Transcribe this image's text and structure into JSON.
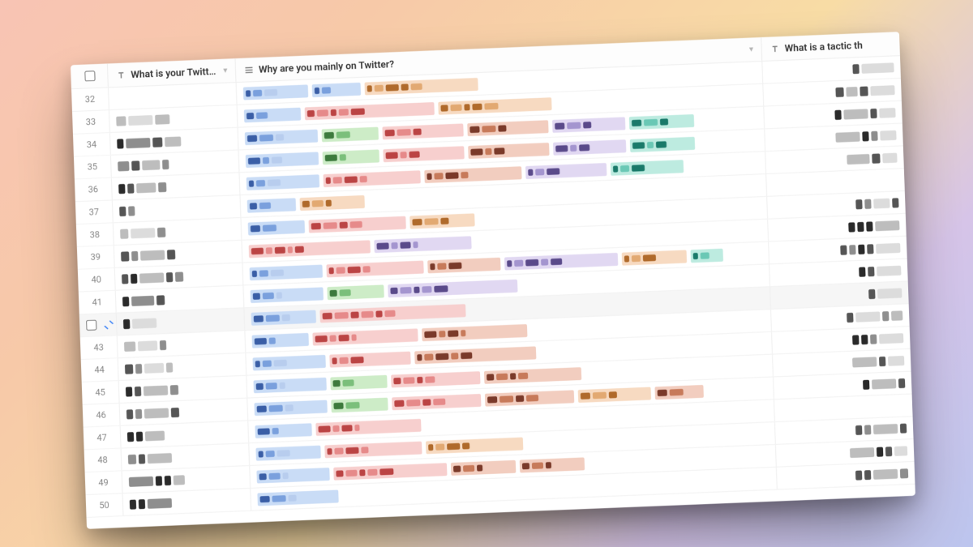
{
  "header": {
    "col1": "What is your Twitte…",
    "col2": "Why are you mainly on Twitter?",
    "col3": "What is a tactic th"
  },
  "chips": {
    "blue": "#c9dcf6",
    "green": "#cdecc7",
    "pink": "#f7cfce",
    "orange": "#f7dac1",
    "violet": "#e1d8f2",
    "rust": "#f2cdbf",
    "teal": "#bdebe0",
    "tan": "#f3e6c9"
  },
  "rows": [
    {
      "n": "32",
      "sel": false,
      "c1": [],
      "tags": [
        [
          "blue",
          80
        ],
        [
          "blue",
          60
        ],
        [
          "orange",
          140
        ]
      ],
      "c3": [
        [
          8,
          "g4"
        ],
        [
          40,
          "g1"
        ]
      ]
    },
    {
      "n": "33",
      "sel": false,
      "c1": [
        [
          12,
          "g2"
        ],
        [
          30,
          "g1"
        ],
        [
          18,
          "g2"
        ]
      ],
      "tags": [
        [
          "blue",
          70
        ],
        [
          "pink",
          160
        ],
        [
          "orange",
          140
        ]
      ],
      "c3": [
        [
          10,
          "g4"
        ],
        [
          14,
          "g2"
        ],
        [
          10,
          "g4"
        ],
        [
          30,
          "g1"
        ]
      ]
    },
    {
      "n": "34",
      "sel": false,
      "c1": [
        [
          8,
          "g5"
        ],
        [
          30,
          "g3"
        ],
        [
          12,
          "g4"
        ],
        [
          20,
          "g2"
        ]
      ],
      "tags": [
        [
          "blue",
          90
        ],
        [
          "green",
          70
        ],
        [
          "pink",
          100
        ],
        [
          "rust",
          100
        ],
        [
          "violet",
          90
        ],
        [
          "teal",
          80
        ]
      ],
      "c3": [
        [
          8,
          "g5"
        ],
        [
          30,
          "g2"
        ],
        [
          8,
          "g4"
        ],
        [
          20,
          "g1"
        ]
      ]
    },
    {
      "n": "35",
      "sel": false,
      "c1": [
        [
          14,
          "g3"
        ],
        [
          10,
          "g4"
        ],
        [
          22,
          "g2"
        ],
        [
          8,
          "g3"
        ]
      ],
      "tags": [
        [
          "blue",
          90
        ],
        [
          "green",
          70
        ],
        [
          "pink",
          100
        ],
        [
          "rust",
          100
        ],
        [
          "violet",
          90
        ],
        [
          "teal",
          80
        ]
      ],
      "c3": [
        [
          30,
          "g2"
        ],
        [
          8,
          "g5"
        ],
        [
          8,
          "g3"
        ],
        [
          20,
          "g1"
        ]
      ]
    },
    {
      "n": "36",
      "sel": false,
      "c1": [
        [
          8,
          "g5"
        ],
        [
          8,
          "g4"
        ],
        [
          24,
          "g2"
        ],
        [
          10,
          "g3"
        ]
      ],
      "tags": [
        [
          "blue",
          90
        ],
        [
          "pink",
          120
        ],
        [
          "rust",
          120
        ],
        [
          "violet",
          100
        ],
        [
          "teal",
          90
        ]
      ],
      "c3": [
        [
          28,
          "g2"
        ],
        [
          10,
          "g4"
        ],
        [
          18,
          "g1"
        ]
      ]
    },
    {
      "n": "37",
      "sel": false,
      "c1": [
        [
          8,
          "g4"
        ],
        [
          8,
          "g3"
        ]
      ],
      "tags": [
        [
          "blue",
          60
        ],
        [
          "orange",
          80
        ]
      ],
      "c3": []
    },
    {
      "n": "38",
      "sel": false,
      "c1": [
        [
          10,
          "g2"
        ],
        [
          30,
          "g1"
        ],
        [
          10,
          "g3"
        ]
      ],
      "tags": [
        [
          "blue",
          70
        ],
        [
          "pink",
          120
        ],
        [
          "orange",
          80
        ]
      ],
      "c3": [
        [
          8,
          "g4"
        ],
        [
          8,
          "g3"
        ],
        [
          20,
          "g1"
        ],
        [
          8,
          "g4"
        ]
      ]
    },
    {
      "n": "39",
      "sel": false,
      "c1": [
        [
          10,
          "g4"
        ],
        [
          8,
          "g3"
        ],
        [
          30,
          "g2"
        ],
        [
          10,
          "g4"
        ]
      ],
      "tags": [
        [
          "pink",
          150
        ],
        [
          "violet",
          120
        ]
      ],
      "c3": [
        [
          8,
          "g5"
        ],
        [
          8,
          "g5"
        ],
        [
          8,
          "g5"
        ],
        [
          30,
          "g2"
        ]
      ]
    },
    {
      "n": "40",
      "sel": false,
      "c1": [
        [
          8,
          "g4"
        ],
        [
          8,
          "g5"
        ],
        [
          30,
          "g2"
        ],
        [
          8,
          "g4"
        ],
        [
          10,
          "g3"
        ]
      ],
      "tags": [
        [
          "blue",
          90
        ],
        [
          "pink",
          120
        ],
        [
          "rust",
          90
        ],
        [
          "violet",
          140
        ],
        [
          "orange",
          80
        ],
        [
          "teal",
          40
        ]
      ],
      "c3": [
        [
          8,
          "g4"
        ],
        [
          8,
          "g3"
        ],
        [
          8,
          "g5"
        ],
        [
          8,
          "g4"
        ],
        [
          30,
          "g1"
        ]
      ]
    },
    {
      "n": "41",
      "sel": false,
      "c1": [
        [
          8,
          "g5"
        ],
        [
          28,
          "g3"
        ],
        [
          10,
          "g4"
        ]
      ],
      "tags": [
        [
          "blue",
          90
        ],
        [
          "green",
          70
        ],
        [
          "violet",
          160
        ]
      ],
      "c3": [
        [
          8,
          "g5"
        ],
        [
          8,
          "g4"
        ],
        [
          30,
          "g1"
        ]
      ]
    },
    {
      "n": "",
      "sel": true,
      "c1": [
        [
          8,
          "g5"
        ],
        [
          30,
          "g1"
        ]
      ],
      "tags": [
        [
          "blue",
          80
        ],
        [
          "pink",
          180
        ]
      ],
      "c3": [
        [
          8,
          "g4"
        ],
        [
          30,
          "g1"
        ]
      ]
    },
    {
      "n": "43",
      "sel": false,
      "c1": [
        [
          14,
          "g2"
        ],
        [
          24,
          "g1"
        ],
        [
          8,
          "g3"
        ]
      ],
      "tags": [
        [
          "blue",
          70
        ],
        [
          "pink",
          130
        ],
        [
          "rust",
          130
        ]
      ],
      "c3": [
        [
          8,
          "g4"
        ],
        [
          30,
          "g1"
        ],
        [
          8,
          "g3"
        ],
        [
          14,
          "g2"
        ]
      ]
    },
    {
      "n": "44",
      "sel": false,
      "c1": [
        [
          10,
          "g4"
        ],
        [
          8,
          "g3"
        ],
        [
          24,
          "g1"
        ],
        [
          8,
          "g2"
        ]
      ],
      "tags": [
        [
          "blue",
          90
        ],
        [
          "pink",
          100
        ],
        [
          "rust",
          150
        ]
      ],
      "c3": [
        [
          8,
          "g5"
        ],
        [
          8,
          "g5"
        ],
        [
          8,
          "g3"
        ],
        [
          30,
          "g1"
        ]
      ]
    },
    {
      "n": "45",
      "sel": false,
      "c1": [
        [
          8,
          "g5"
        ],
        [
          8,
          "g4"
        ],
        [
          30,
          "g2"
        ],
        [
          10,
          "g3"
        ]
      ],
      "tags": [
        [
          "blue",
          90
        ],
        [
          "green",
          70
        ],
        [
          "pink",
          110
        ],
        [
          "rust",
          120
        ]
      ],
      "c3": [
        [
          30,
          "g2"
        ],
        [
          8,
          "g4"
        ],
        [
          20,
          "g1"
        ]
      ]
    },
    {
      "n": "46",
      "sel": false,
      "c1": [
        [
          8,
          "g4"
        ],
        [
          8,
          "g3"
        ],
        [
          30,
          "g2"
        ],
        [
          10,
          "g4"
        ]
      ],
      "tags": [
        [
          "blue",
          90
        ],
        [
          "green",
          70
        ],
        [
          "pink",
          110
        ],
        [
          "rust",
          110
        ],
        [
          "orange",
          90
        ],
        [
          "rust",
          60
        ]
      ],
      "c3": [
        [
          8,
          "g5"
        ],
        [
          30,
          "g2"
        ],
        [
          8,
          "g4"
        ]
      ]
    },
    {
      "n": "47",
      "sel": false,
      "c1": [
        [
          8,
          "g5"
        ],
        [
          8,
          "g5"
        ],
        [
          24,
          "g2"
        ]
      ],
      "tags": [
        [
          "blue",
          70
        ],
        [
          "pink",
          130
        ]
      ],
      "c3": []
    },
    {
      "n": "48",
      "sel": false,
      "c1": [
        [
          10,
          "g3"
        ],
        [
          8,
          "g4"
        ],
        [
          30,
          "g2"
        ]
      ],
      "tags": [
        [
          "blue",
          80
        ],
        [
          "pink",
          120
        ],
        [
          "orange",
          120
        ]
      ],
      "c3": [
        [
          8,
          "g4"
        ],
        [
          8,
          "g3"
        ],
        [
          30,
          "g2"
        ],
        [
          8,
          "g4"
        ]
      ]
    },
    {
      "n": "49",
      "sel": false,
      "c1": [
        [
          30,
          "g3"
        ],
        [
          8,
          "g5"
        ],
        [
          8,
          "g5"
        ],
        [
          14,
          "g2"
        ]
      ],
      "tags": [
        [
          "blue",
          90
        ],
        [
          "pink",
          140
        ],
        [
          "rust",
          80
        ],
        [
          "rust",
          80
        ]
      ],
      "c3": [
        [
          30,
          "g2"
        ],
        [
          8,
          "g5"
        ],
        [
          8,
          "g4"
        ],
        [
          16,
          "g1"
        ]
      ]
    },
    {
      "n": "50",
      "sel": false,
      "c1": [
        [
          8,
          "g5"
        ],
        [
          8,
          "g5"
        ],
        [
          30,
          "g3"
        ]
      ],
      "tags": [
        [
          "blue",
          100
        ]
      ],
      "c3": [
        [
          8,
          "g4"
        ],
        [
          8,
          "g4"
        ],
        [
          30,
          "g2"
        ],
        [
          10,
          "g3"
        ]
      ]
    }
  ],
  "chip_classes": {
    "blue": "cb",
    "green": "cg",
    "pink": "cp",
    "orange": "co",
    "violet": "cv",
    "rust": "cr",
    "teal": "ct",
    "tan": "cm"
  },
  "chip_inners": {
    "blue": [
      "ib",
      "ib2",
      "ib3",
      "ib"
    ],
    "green": [
      "ig",
      "ig2",
      "ig"
    ],
    "pink": [
      "ip",
      "ip2",
      "ip",
      "ip2"
    ],
    "orange": [
      "io",
      "io2",
      "io"
    ],
    "violet": [
      "iv",
      "iv2",
      "iv",
      "iv2"
    ],
    "rust": [
      "ir",
      "ir2",
      "ir",
      "ir2"
    ],
    "teal": [
      "it",
      "it2",
      "it"
    ],
    "tan": [
      "io2",
      "io"
    ]
  }
}
